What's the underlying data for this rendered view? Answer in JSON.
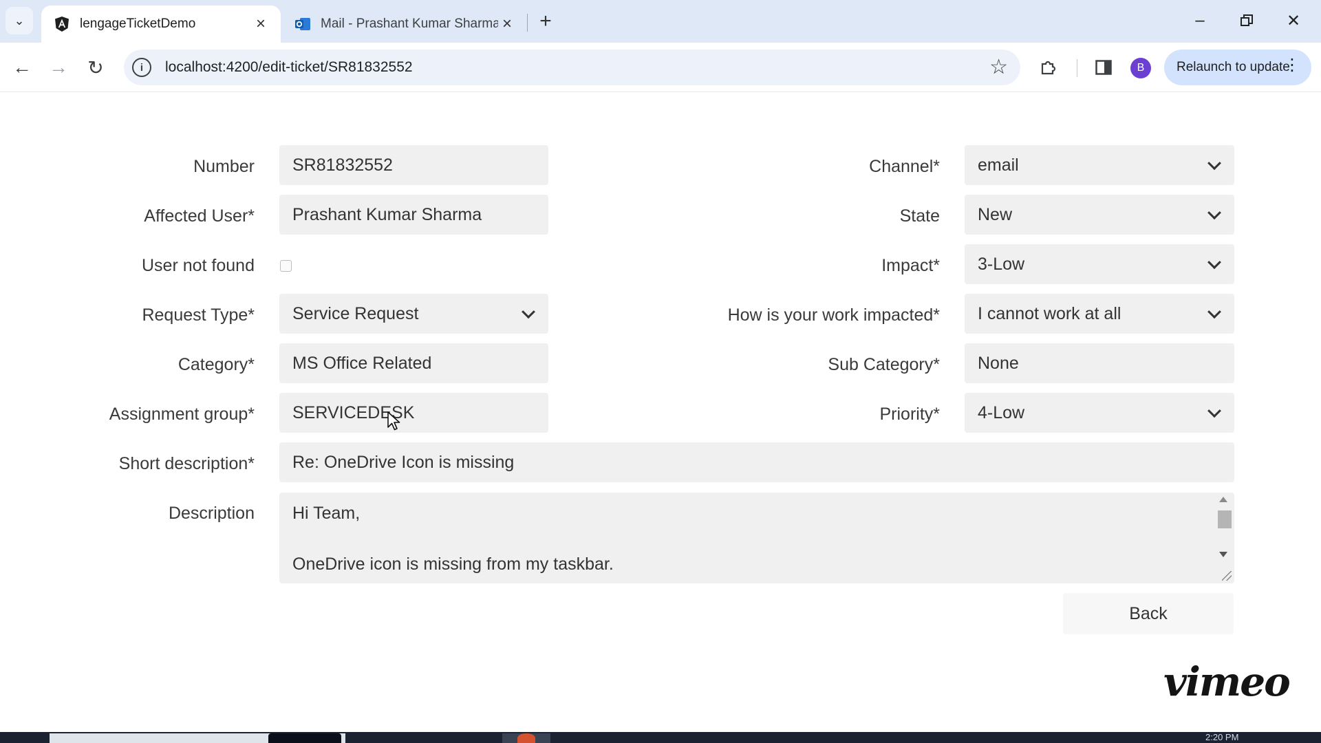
{
  "browser": {
    "tabs": [
      {
        "title": "lengageTicketDemo",
        "active": true
      },
      {
        "title": "Mail - Prashant Kumar Sharma",
        "active": false
      }
    ],
    "url": "localhost:4200/edit-ticket/SR81832552",
    "profile_initial": "B",
    "relaunch_label": "Relaunch to update"
  },
  "form": {
    "number": {
      "label": "Number",
      "value": "SR81832552"
    },
    "affected_user": {
      "label": "Affected User*",
      "value": "Prashant Kumar Sharma"
    },
    "user_not_found": {
      "label": "User not found",
      "checked": false
    },
    "request_type": {
      "label": "Request Type*",
      "value": "Service Request"
    },
    "category": {
      "label": "Category*",
      "value": "MS Office Related"
    },
    "assignment_group": {
      "label": "Assignment group*",
      "value": "SERVICEDESK"
    },
    "channel": {
      "label": "Channel*",
      "value": "email"
    },
    "state": {
      "label": "State",
      "value": "New"
    },
    "impact": {
      "label": "Impact*",
      "value": "3-Low"
    },
    "work_impacted": {
      "label": "How is your work impacted*",
      "value": "I cannot work at all"
    },
    "sub_category": {
      "label": "Sub Category*",
      "value": "None"
    },
    "priority": {
      "label": "Priority*",
      "value": "4-Low"
    },
    "short_description": {
      "label": "Short description*",
      "value": "Re: OneDrive Icon is missing"
    },
    "description": {
      "label": "Description",
      "lines": [
        "Hi Team,",
        "",
        "OneDrive icon is missing from my taskbar."
      ]
    },
    "back_label": "Back"
  },
  "overlay": {
    "watermark": "vimeo",
    "clock_fragment": "2:20 PM"
  }
}
